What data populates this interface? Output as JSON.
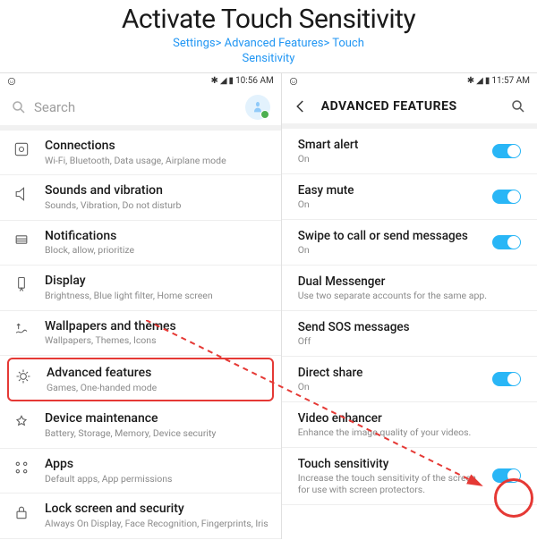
{
  "header": {
    "title": "Activate Touch Sensitivity",
    "subtitle_line1": "Settings> Advanced Features> Touch",
    "subtitle_line2": "Sensitivity"
  },
  "phone1": {
    "status_time": "10:56 AM",
    "search_placeholder": "Search",
    "items": [
      {
        "id": "connections",
        "label": "Connections",
        "desc": "Wi-Fi, Bluetooth, Data usage, Airplane mode"
      },
      {
        "id": "sounds",
        "label": "Sounds and vibration",
        "desc": "Sounds, Vibration, Do not disturb"
      },
      {
        "id": "notifications",
        "label": "Notifications",
        "desc": "Block, allow, prioritize"
      },
      {
        "id": "display",
        "label": "Display",
        "desc": "Brightness, Blue light filter, Home screen"
      },
      {
        "id": "wallpapers",
        "label": "Wallpapers and themes",
        "desc": "Wallpapers, Themes, Icons"
      },
      {
        "id": "advanced",
        "label": "Advanced features",
        "desc": "Games, One-handed mode",
        "highlight": true
      },
      {
        "id": "maintenance",
        "label": "Device maintenance",
        "desc": "Battery, Storage, Memory, Device security"
      },
      {
        "id": "apps",
        "label": "Apps",
        "desc": "Default apps, App permissions"
      },
      {
        "id": "lock",
        "label": "Lock screen and security",
        "desc": "Always On Display, Face Recognition, Fingerprints, Iris"
      }
    ]
  },
  "phone2": {
    "status_time": "11:57 AM",
    "header": "ADVANCED FEATURES",
    "items": [
      {
        "label": "Smart alert",
        "desc": "On",
        "toggle": true
      },
      {
        "label": "Easy mute",
        "desc": "On",
        "toggle": true
      },
      {
        "label": "Swipe to call or send messages",
        "desc": "On",
        "toggle": true
      },
      {
        "label": "Dual Messenger",
        "desc": "Use two separate accounts for the same app.",
        "toggle": null
      },
      {
        "label": "Send SOS messages",
        "desc": "Off",
        "toggle": null
      },
      {
        "label": "Direct share",
        "desc": "On",
        "toggle": true
      },
      {
        "label": "Video enhancer",
        "desc": "Enhance the image quality of your videos.",
        "toggle": null
      },
      {
        "label": "Touch sensitivity",
        "desc": "Increase the touch sensitivity of the screen for use with screen protectors.",
        "toggle": true,
        "circled": true
      }
    ]
  }
}
